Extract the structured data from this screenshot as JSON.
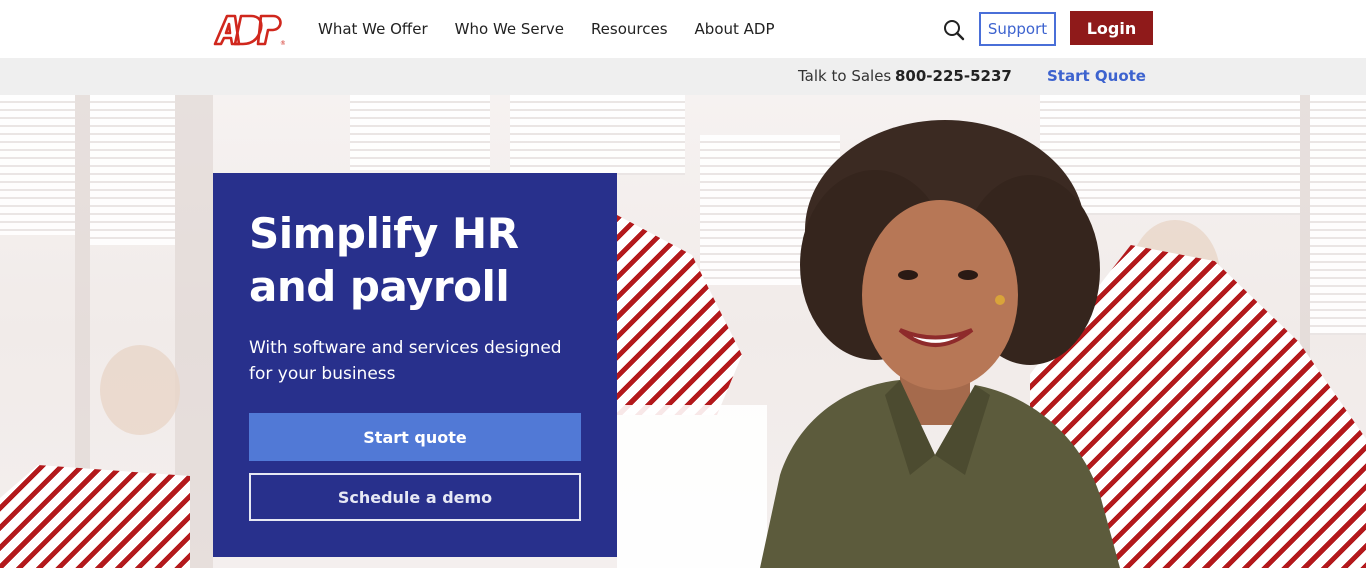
{
  "header": {
    "logo_text": "ADP",
    "nav": [
      {
        "label": "What We Offer"
      },
      {
        "label": "Who We Serve"
      },
      {
        "label": "Resources"
      },
      {
        "label": "About ADP"
      }
    ],
    "support_label": "Support",
    "login_label": "Login"
  },
  "subbar": {
    "talk_label": "Talk to Sales",
    "phone": "800-225-5237",
    "start_quote": "Start Quote"
  },
  "hero": {
    "title": "Simplify HR and payroll",
    "subtitle": "With software and services designed for your business",
    "primary_button": "Start quote",
    "secondary_button": "Schedule a demo"
  },
  "colors": {
    "brand_red": "#d0271d",
    "login_bg": "#8f1a1a",
    "card_blue": "#28308c",
    "button_blue": "#5179d6",
    "link_blue": "#3d63cf"
  },
  "icons": {
    "search": "search-icon",
    "logo": "adp-logo"
  }
}
